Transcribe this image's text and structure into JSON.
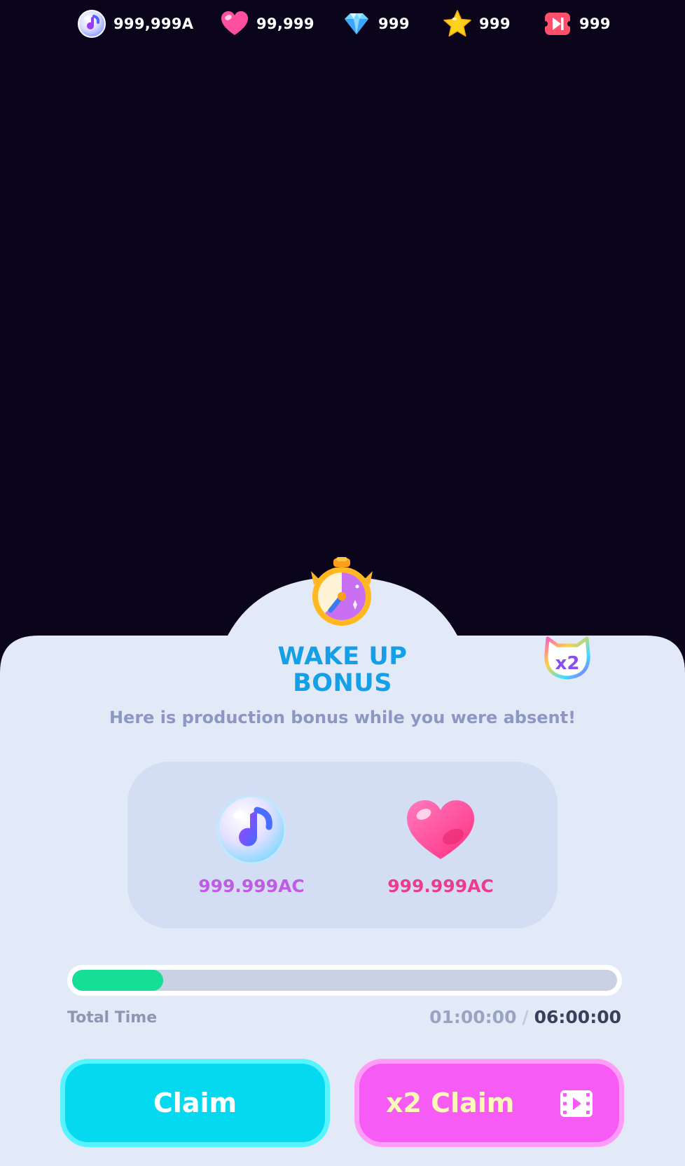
{
  "resources": [
    {
      "icon": "music-note-orb-icon",
      "value": "999,999A"
    },
    {
      "icon": "heart-icon",
      "value": "99,999"
    },
    {
      "icon": "diamond-icon",
      "value": "999"
    },
    {
      "icon": "star-icon",
      "value": "999"
    },
    {
      "icon": "video-ticket-icon",
      "value": "999"
    }
  ],
  "bonus": {
    "title_line1": "WAKE UP",
    "title_line2": "BONUS",
    "multiplier_badge": "x2",
    "subtitle": "Here is production bonus while you were absent!",
    "rewards": [
      {
        "icon": "music-note-orb-icon",
        "value": "999.999AC",
        "color": "#c05be4"
      },
      {
        "icon": "heart-icon",
        "value": "999.999AC",
        "color": "#ee3c8c"
      }
    ],
    "progress_fraction": 0.1667,
    "total_time_label": "Total Time",
    "elapsed_time": "01:00:00",
    "separator": "/",
    "total_time": "06:00:00"
  },
  "buttons": {
    "claim_label": "Claim",
    "x2_claim_label": "x2 Claim"
  },
  "colors": {
    "background": "#0b051b",
    "panel": "#e2e9f7",
    "title": "#159fe6",
    "claim": "#05d9ef",
    "x2_claim": "#f65cf5",
    "progress_fill": "#15de95"
  }
}
